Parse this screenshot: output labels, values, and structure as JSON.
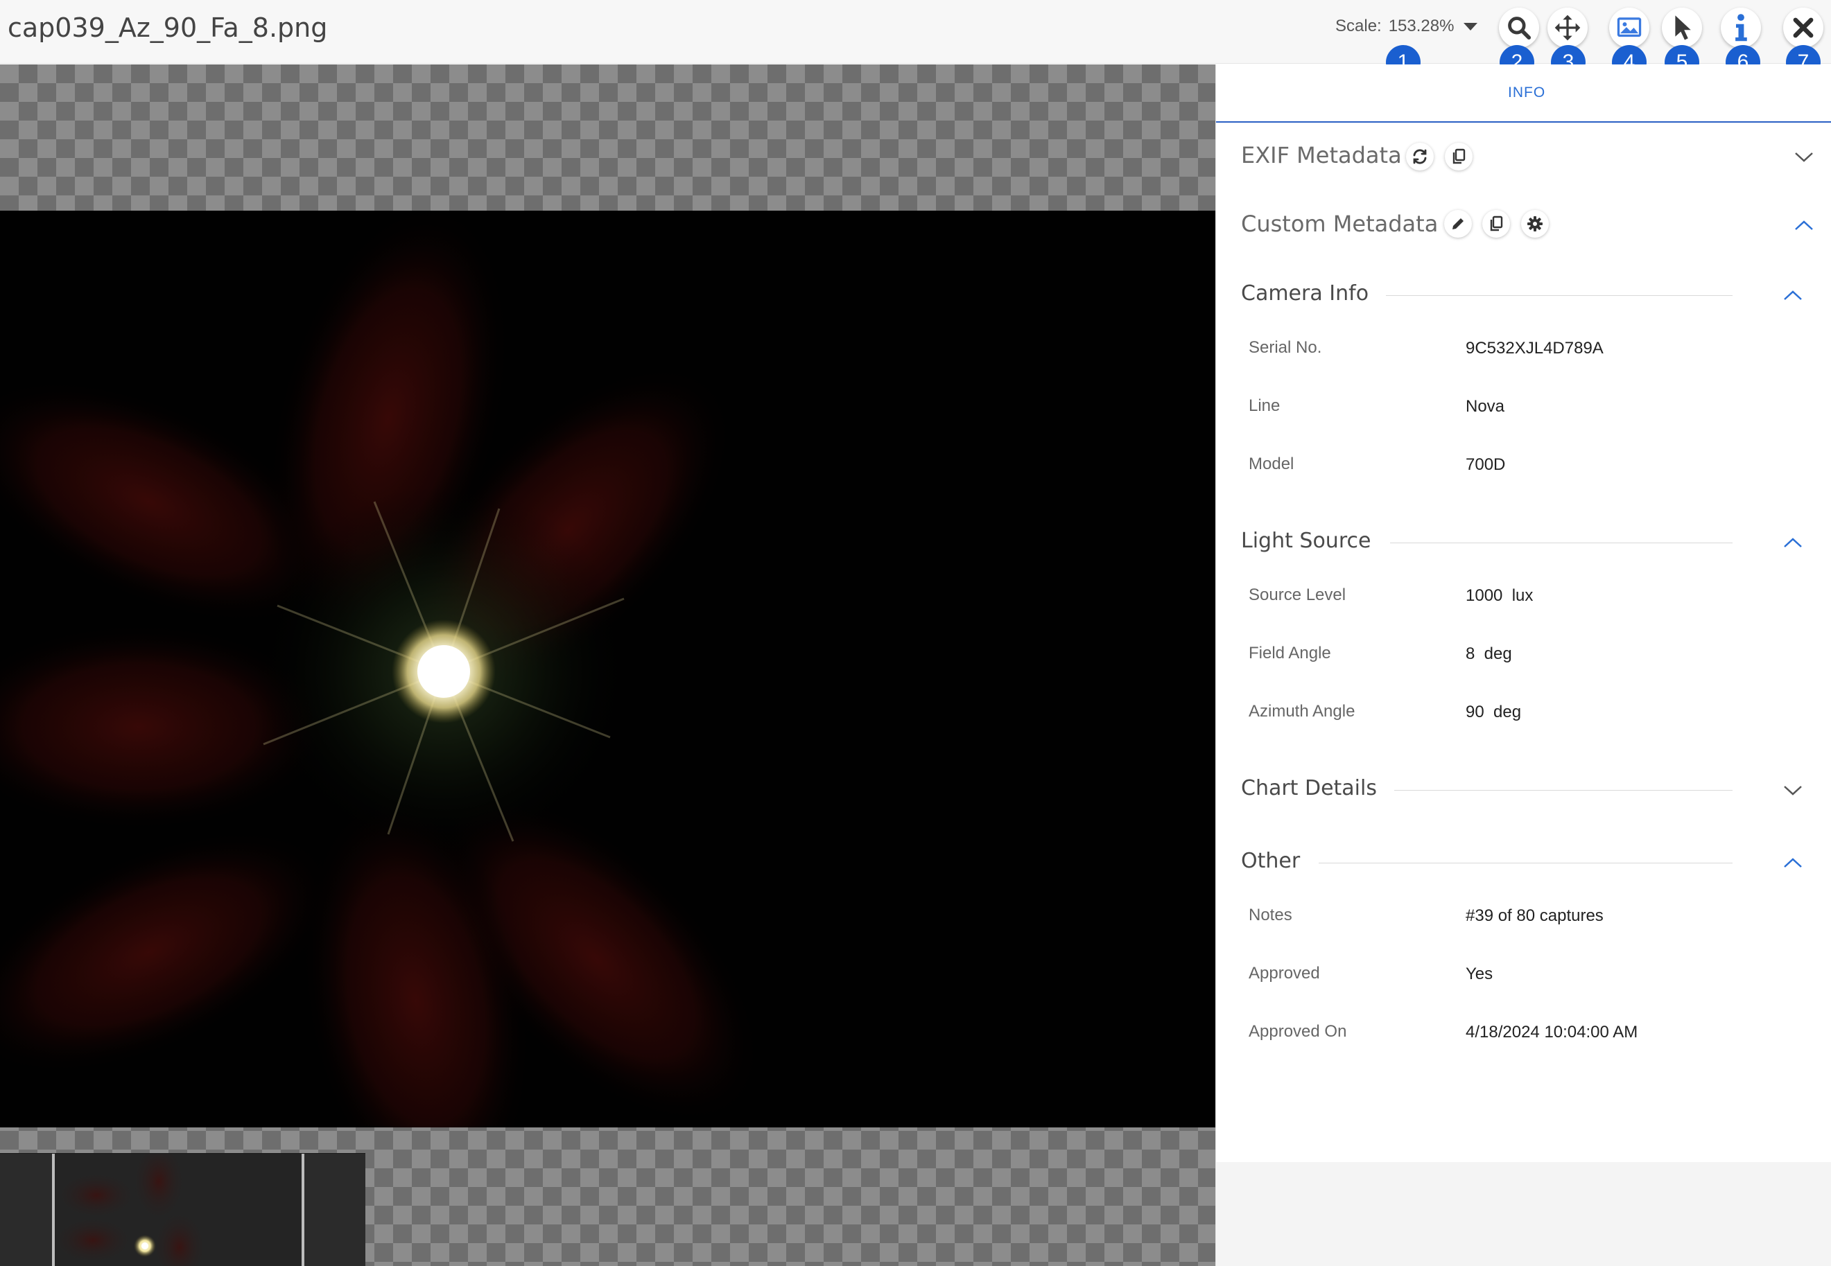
{
  "header": {
    "filename": "cap039_Az_90_Fa_8.png",
    "scale_label": "Scale:",
    "scale_value": "153.28%"
  },
  "toolbar": {
    "badges": [
      "1",
      "2",
      "3",
      "4",
      "5",
      "6",
      "7"
    ],
    "tools": [
      {
        "icon": "search-icon",
        "badge": "2"
      },
      {
        "icon": "move-icon",
        "badge": "3"
      },
      {
        "icon": "image-icon",
        "badge": "4"
      },
      {
        "icon": "pointer-icon",
        "badge": "5"
      },
      {
        "icon": "info-icon",
        "badge": "6"
      },
      {
        "icon": "close-icon",
        "badge": "7"
      }
    ],
    "active_caption": "INFO",
    "accent_color": "#1a5fd0"
  },
  "panel": {
    "exif_title": "EXIF Metadata",
    "custom_title": "Custom Metadata",
    "groups": {
      "camera": {
        "title": "Camera Info",
        "fields": [
          {
            "label": "Serial No.",
            "value": "9C532XJL4D789A"
          },
          {
            "label": "Line",
            "value": "Nova"
          },
          {
            "label": "Model",
            "value": "700D"
          }
        ]
      },
      "light": {
        "title": "Light Source",
        "fields": [
          {
            "label": "Source Level",
            "value": "1000  lux"
          },
          {
            "label": "Field Angle",
            "value": "8  deg"
          },
          {
            "label": "Azimuth Angle",
            "value": "90  deg"
          }
        ]
      },
      "chart": {
        "title": "Chart Details"
      },
      "other": {
        "title": "Other",
        "fields": [
          {
            "label": "Notes",
            "value": "#39 of 80 captures"
          },
          {
            "label": "Approved",
            "value": "Yes"
          },
          {
            "label": "Approved On",
            "value": "4/18/2024 10:04:00 AM"
          }
        ]
      }
    }
  }
}
